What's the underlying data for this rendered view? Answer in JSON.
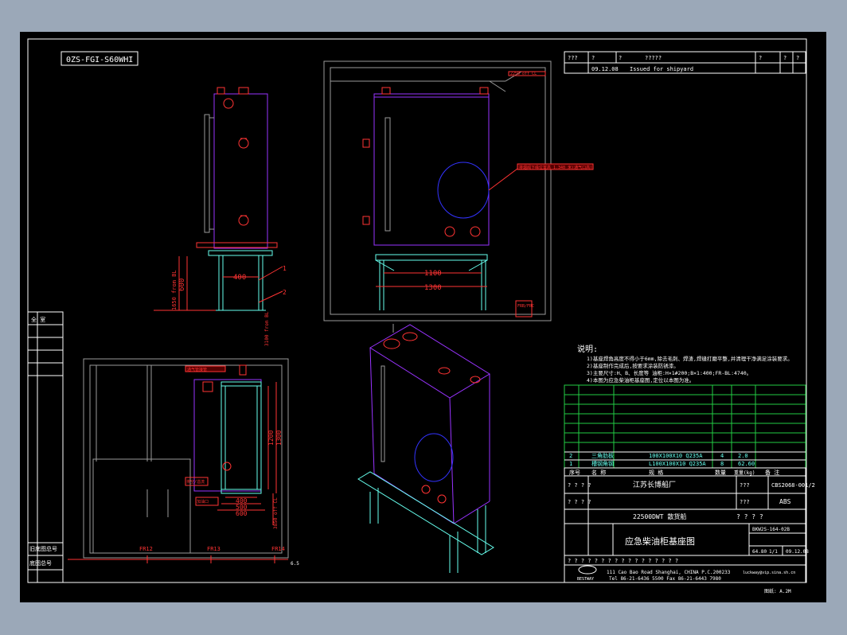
{
  "colors": {
    "background": "#9ba8b8",
    "sheet": "#000000",
    "frame": "#ffffff",
    "tank": "#9933ff",
    "support": "#66ffee",
    "dimension": "#ff3333",
    "table_grid": "#22cc44",
    "cad_gray": "#9a9a9a"
  },
  "drawing_code": "0ZS-FGI-S60WHI",
  "revision": {
    "header": [
      "???",
      "?",
      "?",
      "?????",
      "?",
      "?",
      "?"
    ],
    "row": {
      "date": "09.12.08",
      "desc": "Issued for shipyard"
    }
  },
  "left_labels": {
    "top": "全  室",
    "bottom1": "旧底图总号",
    "bottom2": "底图总号"
  },
  "views": {
    "front": {
      "dims": {
        "d400": "400",
        "d600": "600",
        "from_bl": "1650 from BL",
        "ref_bl": "3100 from BL"
      },
      "leaders": [
        "1",
        "2"
      ]
    },
    "side": {
      "label": "2250 off CL",
      "callout": "排烟阀下缘位置高 1.340 米(通气口高)",
      "dims": {
        "d1100": "1100",
        "d1300": "1300"
      },
      "tag": "FRB/FRC"
    },
    "plan": {
      "dims": {
        "d400": "400",
        "d500": "500",
        "d600": "600",
        "d1200": "1200",
        "d1300": "1300",
        "d30": "3850 off CL"
      },
      "frames": [
        "FR12",
        "FR13",
        "FR14"
      ],
      "tags": [
        "排空/溢流",
        "加油口"
      ],
      "vent": "通气管接管",
      "scale_mark": "6.5"
    }
  },
  "notes": {
    "title": "说明:",
    "lines": [
      "1)基座焊角高度不得小于6mm,除去毛刺、焊渣,焊缝打磨平整,并清理干净满足涂装要求。",
      "2)基座制作完成后,按要求涂装防锈漆。",
      "3)主要尺寸:H、B、长度等  油柜:H×1#200;B×1:400;FR-BL:4740。",
      "4)本图为应急柴油柜基座图,定位以本图为准。"
    ]
  },
  "bom": {
    "rows": [
      {
        "no": "2",
        "name": "三角肋板",
        "spec": "100X100X10 Q235A",
        "qty": "4",
        "weight": "2.0",
        "remark": ""
      },
      {
        "no": "1",
        "name": "槽钢角钢",
        "spec": "L100X100X10 Q235A",
        "qty": "8",
        "weight": "62.60",
        "remark": ""
      }
    ],
    "header": {
      "no": "序号",
      "name": "名 称",
      "spec": "规    格",
      "qty": "数量",
      "weight": "重量(kg)",
      "remark": "备 注"
    }
  },
  "title_block": {
    "shipyard": "江苏长博船厂",
    "project": "CBS2068-001/2",
    "class_label": "???",
    "class": "ABS",
    "vessel": "22500DWT 散货船",
    "qmarks": "? ? ? ?",
    "drawing_no": "BKW2S-164-02B",
    "title": "应急柴油柜基座图",
    "scale": "1:1",
    "date": "09.12.08",
    "weight": "64.80",
    "sheet": "1/1",
    "qrow": "? ? ? ? ? ? ? ? ? ? ? ? ? ? ? ? ?",
    "company": "BESTWAY",
    "address": "111 Cao Bao Road Shanghai, CHINA   P.C.200233",
    "tel": "Tel 86-21-6436 5500  Fax 86-21-6443 7980",
    "email": "luckway@vip.sina.sh.cn",
    "paper": "图纸: A.2M"
  }
}
